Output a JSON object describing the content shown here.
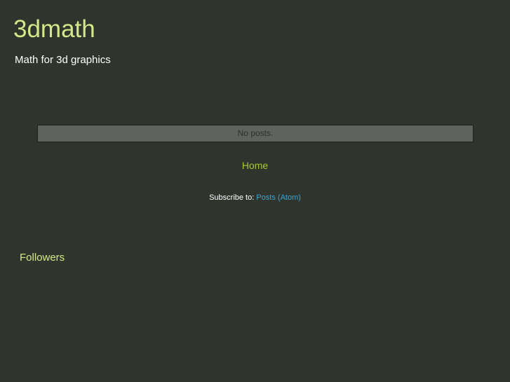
{
  "header": {
    "title": "3dmath",
    "description": "Math for 3d graphics"
  },
  "main": {
    "empty_message": "No posts."
  },
  "nav": {
    "home_label": "Home"
  },
  "feed": {
    "subscribe_label": "Subscribe to:",
    "posts_atom_label": "Posts (Atom)"
  },
  "sidebar": {
    "followers_title": "Followers"
  },
  "colors": {
    "background": "#2f352d",
    "title": "#d4e88a",
    "link": "#a6c93a",
    "feed_link": "#3aa4d6"
  }
}
